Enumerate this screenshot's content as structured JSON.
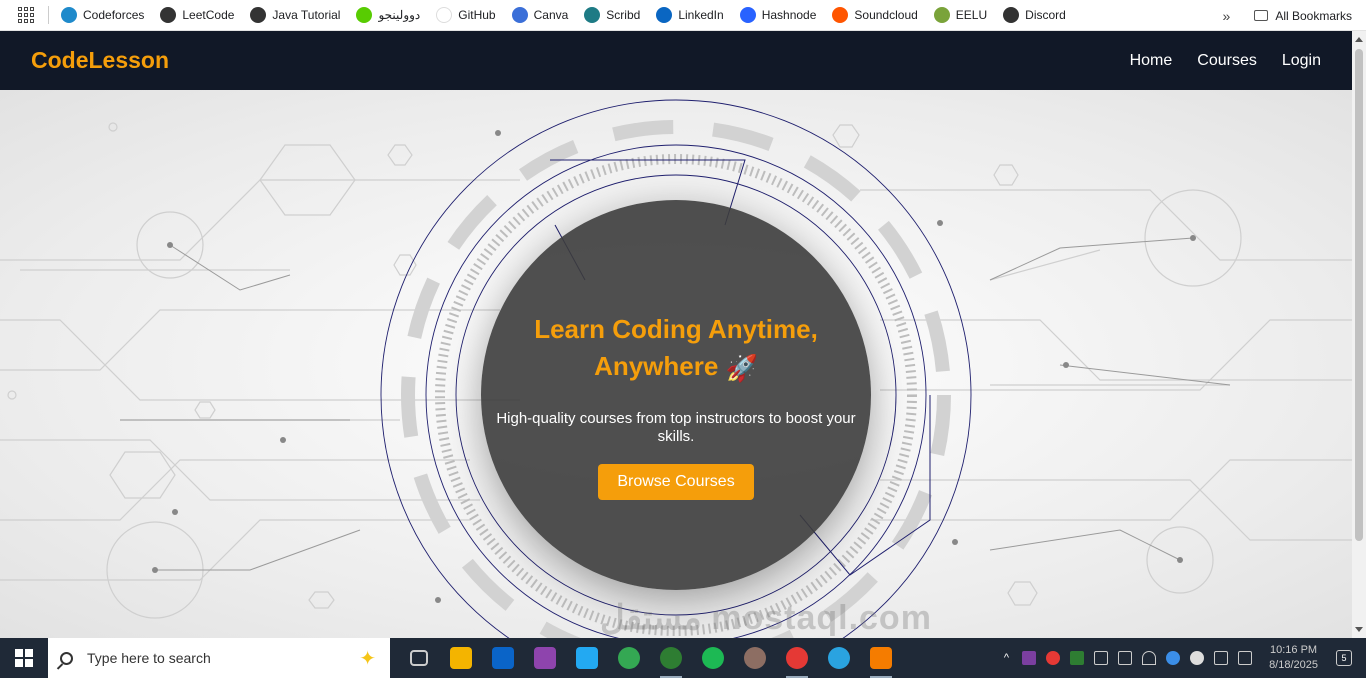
{
  "bookmarks": {
    "items": [
      {
        "label": "Codeforces",
        "icon": "codeforces-icon",
        "color": "#1f8acb"
      },
      {
        "label": "LeetCode",
        "icon": "globe-icon",
        "color": "#333333"
      },
      {
        "label": "Java Tutorial",
        "icon": "globe-icon",
        "color": "#333333"
      },
      {
        "label": "دوولينجو",
        "icon": "duolingo-icon",
        "color": "#58cc02"
      },
      {
        "label": "GitHub",
        "icon": "github-icon",
        "color": "#ffffff"
      },
      {
        "label": "Canva",
        "icon": "canva-icon",
        "color": "#3b6fd8"
      },
      {
        "label": "Scribd",
        "icon": "scribd-icon",
        "color": "#1e7b85"
      },
      {
        "label": "LinkedIn",
        "icon": "linkedin-icon",
        "color": "#0a66c2"
      },
      {
        "label": "Hashnode",
        "icon": "hashnode-icon",
        "color": "#2962ff"
      },
      {
        "label": "Soundcloud",
        "icon": "soundcloud-icon",
        "color": "#ff5500"
      },
      {
        "label": "EELU",
        "icon": "eelu-icon",
        "color": "#7aa33a"
      },
      {
        "label": "Discord",
        "icon": "globe-icon",
        "color": "#333333"
      }
    ],
    "all_bookmarks": "All Bookmarks",
    "overflow": "»"
  },
  "navbar": {
    "brand": "CodeLesson",
    "links": [
      "Home",
      "Courses",
      "Login"
    ]
  },
  "hero": {
    "title": "Learn Coding Anytime, Anywhere",
    "rocket": "🚀",
    "subtitle": "High-quality courses from top instructors to boost your skills.",
    "button": "Browse Courses",
    "watermark": "مستقل mostaql.com"
  },
  "taskbar": {
    "search_placeholder": "Type here to search",
    "time": "10:16 PM",
    "date": "8/18/2025",
    "notifications": "5",
    "apps": [
      {
        "name": "task-view-icon",
        "color": "#1f2937"
      },
      {
        "name": "file-explorer-icon",
        "color": "#f4b400"
      },
      {
        "name": "outlook-icon",
        "color": "#0a64c8"
      },
      {
        "name": "visual-studio-icon",
        "color": "#8e44ad"
      },
      {
        "name": "vscode-icon",
        "color": "#23a9f2"
      },
      {
        "name": "chrome-icon",
        "color": "#34a853"
      },
      {
        "name": "chrome-profile-icon",
        "color": "#2e7d32"
      },
      {
        "name": "spotify-icon",
        "color": "#1db954"
      },
      {
        "name": "chrome-profile-2-icon",
        "color": "#8d6e63"
      },
      {
        "name": "chrome-profile-3-icon",
        "color": "#e53935"
      },
      {
        "name": "telegram-icon",
        "color": "#2aa3e0"
      },
      {
        "name": "brave-icon",
        "color": "#f57c00"
      }
    ]
  }
}
